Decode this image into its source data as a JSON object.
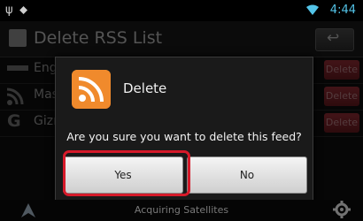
{
  "status_bar": {
    "left_icons": [
      "usb-icon",
      "lock-icon"
    ],
    "time": "4:44",
    "wifi_icon": "wifi-icon"
  },
  "header": {
    "title": "Delete RSS List",
    "back_icon": "back-arrow-icon"
  },
  "feeds": [
    {
      "label": "Enga",
      "icon": "engadget-icon",
      "delete_label": "Delete"
    },
    {
      "label": "Mas",
      "icon": "rss-icon",
      "delete_label": "Delete"
    },
    {
      "label": "Gizn",
      "icon": "google-icon",
      "delete_label": "Delete"
    }
  ],
  "dialog": {
    "title": "Delete",
    "icon": "rss-feed-icon",
    "message": "Are you sure you want to delete this feed?",
    "yes_label": "Yes",
    "no_label": "No"
  },
  "bottom_bar": {
    "status": "Acquiring Satellites",
    "left_icon": "navigation-icon",
    "right_icon": "gear-icon"
  },
  "colors": {
    "accent_time": "#53c4e8",
    "delete_red": "#b5343e",
    "highlight_red": "#d61a2a",
    "rss_orange": "#f08a2c"
  }
}
